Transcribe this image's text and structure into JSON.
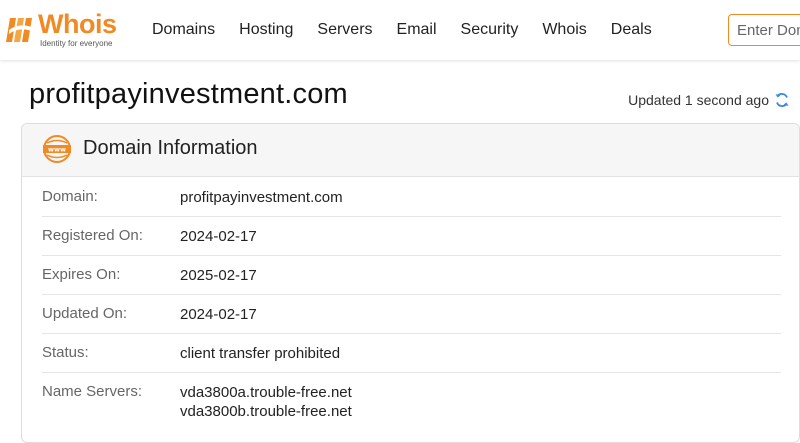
{
  "header": {
    "logo_text": "Whois",
    "logo_tagline": "Identity for everyone",
    "nav": [
      "Domains",
      "Hosting",
      "Servers",
      "Email",
      "Security",
      "Whois",
      "Deals"
    ],
    "search_placeholder": "Enter Domain"
  },
  "page": {
    "title": "profitpayinvestment.com",
    "updated": "Updated 1 second ago"
  },
  "card": {
    "title": "Domain Information",
    "rows": [
      {
        "label": "Domain:",
        "value": "profitpayinvestment.com"
      },
      {
        "label": "Registered On:",
        "value": "2024-02-17"
      },
      {
        "label": "Expires On:",
        "value": "2025-02-17"
      },
      {
        "label": "Updated On:",
        "value": "2024-02-17"
      },
      {
        "label": "Status:",
        "value": "client transfer prohibited"
      },
      {
        "label": "Name Servers:",
        "values": [
          "vda3800a.trouble-free.net",
          "vda3800b.trouble-free.net"
        ]
      }
    ]
  },
  "colors": {
    "brand": "#f08a24",
    "refresh": "#3a8be0"
  },
  "icons": {
    "logo": "whois-logo-icon",
    "refresh": "refresh-icon",
    "www": "www-globe-icon"
  }
}
